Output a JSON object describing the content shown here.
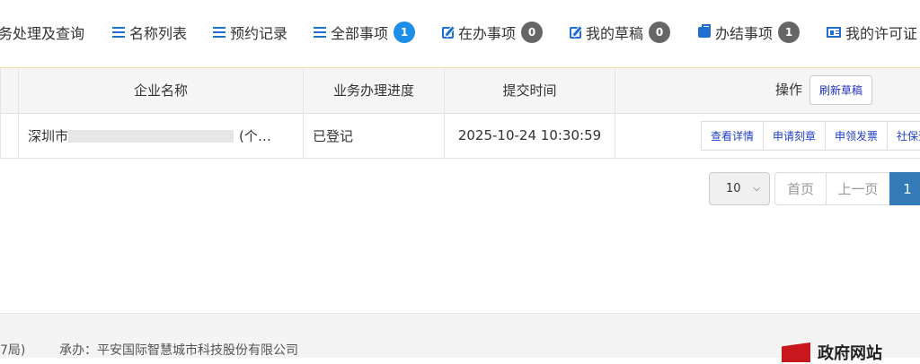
{
  "tabs": [
    {
      "label": "务处理及查询",
      "icon": "none"
    },
    {
      "label": "名称列表",
      "icon": "list-icon"
    },
    {
      "label": "预约记录",
      "icon": "list-icon"
    },
    {
      "label": "全部事项",
      "icon": "list-icon",
      "count": "1",
      "badge_color": "#1e8fe8"
    },
    {
      "label": "在办事项",
      "icon": "edit-icon",
      "count": "0",
      "badge_color": "#666666"
    },
    {
      "label": "我的草稿",
      "icon": "edit-icon",
      "count": "0",
      "badge_color": "#666666"
    },
    {
      "label": "办结事项",
      "icon": "briefcase-icon",
      "count": "1",
      "badge_color": "#666666"
    },
    {
      "label": "我的许可证",
      "icon": "id-card-icon"
    }
  ],
  "table": {
    "headers": {
      "company": "企业名称",
      "progress": "业务办理进度",
      "time": "提交时间",
      "ops": "操作"
    },
    "refresh_label": "刷新草稿",
    "rows": [
      {
        "company_prefix": "深圳市",
        "company_suffix": "(个…",
        "progress": "已登记",
        "time": "2025-10-24 10:30:59",
        "actions": [
          "查看详情",
          "申请刻章",
          "申领发票",
          "社保登记"
        ]
      }
    ]
  },
  "pagination": {
    "page_size": "10",
    "first": "首页",
    "prev": "上一页",
    "current": "1"
  },
  "footer": {
    "left_fragment": "7局)",
    "undertaker": "承办：平安国际智慧城市科技股份有限公司",
    "gov_site": "政府网站"
  },
  "colors": {
    "accent": "#1f6fd1",
    "active_page": "#337ab7",
    "badge_blue": "#1e8fe8"
  }
}
